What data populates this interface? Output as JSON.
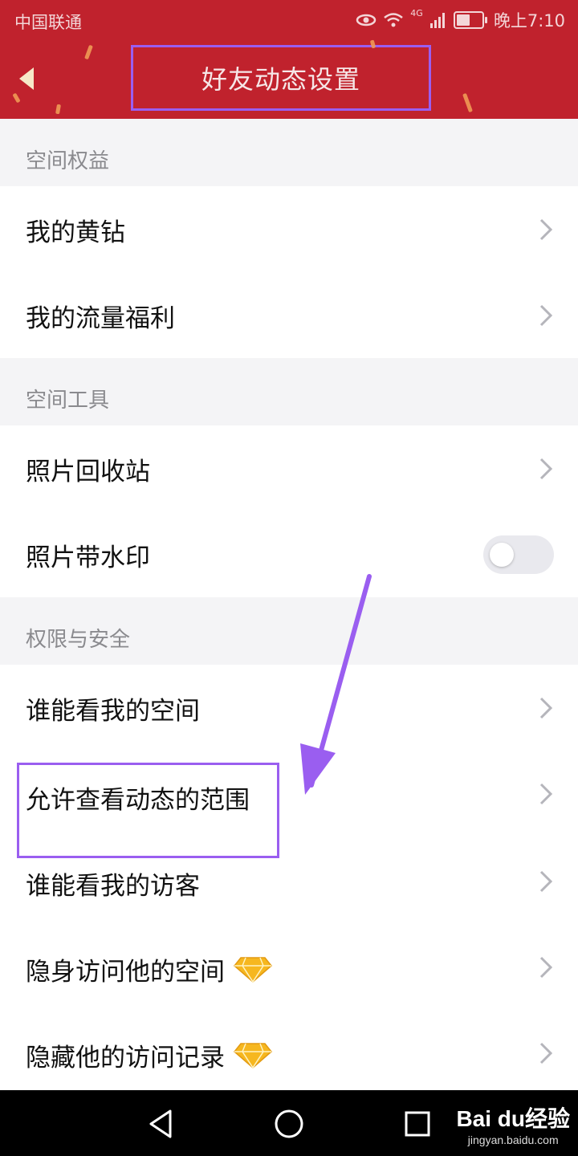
{
  "status_bar": {
    "carrier": "中国联通",
    "network": "4G",
    "time": "晚上7:10"
  },
  "header": {
    "title": "好友动态设置",
    "background_color": "#c0222d",
    "highlight_color": "#9a5ef0"
  },
  "sections": [
    {
      "title": "空间权益",
      "rows": [
        {
          "label": "我的黄钻",
          "control": "chevron"
        },
        {
          "label": "我的流量福利",
          "control": "chevron"
        }
      ]
    },
    {
      "title": "空间工具",
      "rows": [
        {
          "label": "照片回收站",
          "control": "chevron"
        },
        {
          "label": "照片带水印",
          "control": "toggle",
          "toggle_on": false
        }
      ]
    },
    {
      "title": "权限与安全",
      "rows": [
        {
          "label": "谁能看我的空间",
          "control": "chevron"
        },
        {
          "label": "允许查看动态的范围",
          "control": "chevron",
          "highlighted": true
        },
        {
          "label": "谁能看我的访客",
          "control": "chevron"
        },
        {
          "label": "隐身访问他的空间",
          "control": "chevron",
          "badge": "diamond-icon"
        },
        {
          "label": "隐藏他的访问记录",
          "control": "chevron",
          "badge": "diamond-icon"
        }
      ]
    }
  ],
  "watermark": {
    "logo": "Bai du经验",
    "url": "jingyan.baidu.com"
  }
}
